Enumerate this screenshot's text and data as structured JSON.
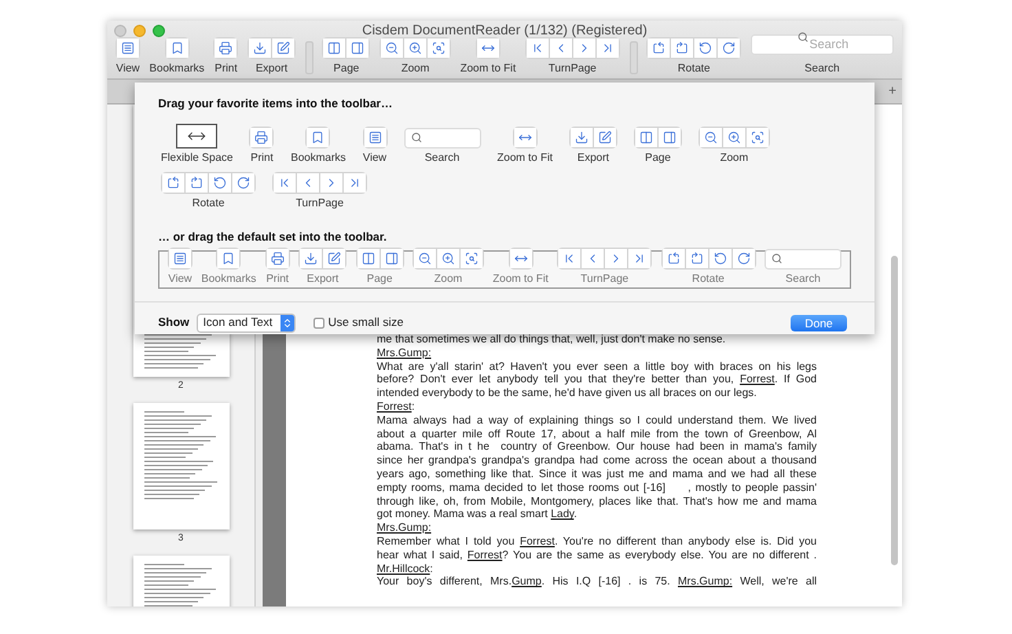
{
  "window": {
    "title": "Cisdem DocumentReader (1/132) (Registered)"
  },
  "toolbar": [
    {
      "kind": "buttons",
      "label": "View",
      "icons": [
        {
          "kind": "view"
        }
      ]
    },
    {
      "kind": "buttons",
      "label": "Bookmarks",
      "icons": [
        {
          "kind": "bookmark"
        }
      ]
    },
    {
      "kind": "buttons",
      "label": "Print",
      "icons": [
        {
          "kind": "print"
        }
      ]
    },
    {
      "kind": "buttons",
      "label": "Export",
      "icons": [
        {
          "kind": "export"
        },
        {
          "kind": "edit"
        }
      ]
    },
    {
      "kind": "spacer"
    },
    {
      "kind": "buttons",
      "label": "Page",
      "icons": [
        {
          "kind": "page-two"
        },
        {
          "kind": "page-side"
        }
      ]
    },
    {
      "kind": "buttons",
      "label": "Zoom",
      "icons": [
        {
          "kind": "zoom-out"
        },
        {
          "kind": "zoom-in"
        },
        {
          "kind": "zoom-actual"
        }
      ]
    },
    {
      "kind": "buttons",
      "label": "Zoom to Fit",
      "icons": [
        {
          "kind": "fit"
        }
      ]
    },
    {
      "kind": "buttons",
      "label": "TurnPage",
      "icons": [
        {
          "kind": "first"
        },
        {
          "kind": "prev"
        },
        {
          "kind": "next"
        },
        {
          "kind": "last"
        }
      ]
    },
    {
      "kind": "spacer"
    },
    {
      "kind": "buttons",
      "label": "Rotate",
      "icons": [
        {
          "kind": "rot-l"
        },
        {
          "kind": "rot-r"
        },
        {
          "kind": "rot-l2"
        },
        {
          "kind": "rot-r2"
        }
      ]
    },
    {
      "kind": "search",
      "label": "Search",
      "placeholder": "Search"
    }
  ],
  "tab_bar": {
    "add": "+"
  },
  "customize_sheet": {
    "heading": "Drag your favorite items into the toolbar…",
    "palette": [
      {
        "kind": "flex",
        "label": "Flexible Space"
      },
      {
        "kind": "buttons",
        "label": "Print",
        "icons": [
          {
            "kind": "print"
          }
        ]
      },
      {
        "kind": "buttons",
        "label": "Bookmarks",
        "icons": [
          {
            "kind": "bookmark"
          }
        ]
      },
      {
        "kind": "buttons",
        "label": "View",
        "icons": [
          {
            "kind": "view"
          }
        ]
      },
      {
        "kind": "search",
        "label": "Search"
      },
      {
        "kind": "buttons",
        "label": "Zoom to Fit",
        "icons": [
          {
            "kind": "fit"
          }
        ]
      },
      {
        "kind": "buttons",
        "label": "Export",
        "icons": [
          {
            "kind": "export"
          },
          {
            "kind": "edit"
          }
        ]
      },
      {
        "kind": "buttons",
        "label": "Page",
        "icons": [
          {
            "kind": "page-two"
          },
          {
            "kind": "page-side"
          }
        ]
      },
      {
        "kind": "buttons",
        "label": "Zoom",
        "icons": [
          {
            "kind": "zoom-out"
          },
          {
            "kind": "zoom-in"
          },
          {
            "kind": "zoom-actual"
          }
        ]
      },
      {
        "kind": "buttons",
        "label": "Rotate",
        "icons": [
          {
            "kind": "rot-l"
          },
          {
            "kind": "rot-r"
          },
          {
            "kind": "rot-l2"
          },
          {
            "kind": "rot-r2"
          }
        ]
      },
      {
        "kind": "buttons",
        "label": "TurnPage",
        "icons": [
          {
            "kind": "first"
          },
          {
            "kind": "prev"
          },
          {
            "kind": "next"
          },
          {
            "kind": "last"
          }
        ]
      }
    ],
    "default_heading": "… or drag the default set into the toolbar.",
    "default_set": [
      {
        "kind": "buttons",
        "label": "View",
        "icons": [
          {
            "kind": "view"
          }
        ]
      },
      {
        "kind": "buttons",
        "label": "Bookmarks",
        "icons": [
          {
            "kind": "bookmark"
          }
        ]
      },
      {
        "kind": "buttons",
        "label": "Print",
        "icons": [
          {
            "kind": "print"
          }
        ]
      },
      {
        "kind": "buttons",
        "label": "Export",
        "icons": [
          {
            "kind": "export"
          },
          {
            "kind": "edit"
          }
        ]
      },
      {
        "kind": "buttons",
        "label": "Page",
        "icons": [
          {
            "kind": "page-two"
          },
          {
            "kind": "page-side"
          }
        ]
      },
      {
        "kind": "buttons",
        "label": "Zoom",
        "icons": [
          {
            "kind": "zoom-out"
          },
          {
            "kind": "zoom-in"
          },
          {
            "kind": "zoom-actual"
          }
        ]
      },
      {
        "kind": "buttons",
        "label": "Zoom to Fit",
        "icons": [
          {
            "kind": "fit"
          }
        ]
      },
      {
        "kind": "buttons",
        "label": "TurnPage",
        "icons": [
          {
            "kind": "first"
          },
          {
            "kind": "prev"
          },
          {
            "kind": "next"
          },
          {
            "kind": "last"
          }
        ]
      },
      {
        "kind": "buttons",
        "label": "Rotate",
        "icons": [
          {
            "kind": "rot-l"
          },
          {
            "kind": "rot-r"
          },
          {
            "kind": "rot-l2"
          },
          {
            "kind": "rot-r2"
          }
        ]
      },
      {
        "kind": "search",
        "label": "Search"
      }
    ],
    "show_label": "Show",
    "show_value": "Icon and Text",
    "small_size": {
      "label": "Use small size",
      "checked": false
    },
    "done": "Done"
  },
  "thumbnails": [
    {
      "page": "2"
    },
    {
      "page": "3"
    }
  ],
  "document_lines": [
    {
      "justified": false,
      "segments": [
        {
          "text": "me that sometimes we all do things that, well, just don't make no sense.",
          "underline": false
        }
      ]
    },
    {
      "justified": false,
      "segments": [
        {
          "text": "Mrs.Gump:",
          "underline": true
        }
      ]
    },
    {
      "justified": true,
      "segments": [
        {
          "text": "What are y'all starin' at? Haven't you ever seen a little boy with braces on his legs",
          "underline": false
        }
      ]
    },
    {
      "justified": true,
      "segments": [
        {
          "text": "before? Don't ever let anybody tell you that they're better than you, ",
          "underline": false
        },
        {
          "text": "Forrest",
          "underline": true
        },
        {
          "text": ". If God",
          "underline": false
        }
      ]
    },
    {
      "justified": false,
      "segments": [
        {
          "text": "intended everybody to be the same, he'd have given us all braces on our legs.",
          "underline": false
        }
      ]
    },
    {
      "justified": false,
      "segments": [
        {
          "text": "Forrest",
          "underline": true
        },
        {
          "text": ":",
          "underline": false
        }
      ]
    },
    {
      "justified": true,
      "segments": [
        {
          "text": "Mama always had a way of explaining things so I could understand them. We lived",
          "underline": false
        }
      ]
    },
    {
      "justified": true,
      "segments": [
        {
          "text": "about a quarter mile off Route 17, about a half mile from the town of Greenbow, Al",
          "underline": false
        }
      ]
    },
    {
      "justified": true,
      "segments": [
        {
          "text": "abama. That's in t he  country of Greenbow. Our house had been in mama's family",
          "underline": false
        }
      ]
    },
    {
      "justified": true,
      "segments": [
        {
          "text": "since her grandpa's grandpa's grandpa had come across the ocean about a thousand",
          "underline": false
        }
      ]
    },
    {
      "justified": true,
      "segments": [
        {
          "text": "years ago, something like that. Since it was just me and mama and we had all these",
          "underline": false
        }
      ]
    },
    {
      "justified": true,
      "segments": [
        {
          "text": "empty rooms, mama decided to let those rooms out [-16]     , mostly to people passin'",
          "underline": false
        }
      ]
    },
    {
      "justified": true,
      "segments": [
        {
          "text": "through like, oh, from Mobile, Montgomery, places like that. That's how me and mama",
          "underline": false
        }
      ]
    },
    {
      "justified": false,
      "segments": [
        {
          "text": "got money. Mama was a real smart ",
          "underline": false
        },
        {
          "text": "Lady",
          "underline": true
        },
        {
          "text": ".",
          "underline": false
        }
      ]
    },
    {
      "justified": false,
      "segments": [
        {
          "text": "Mrs.Gump:",
          "underline": true
        }
      ]
    },
    {
      "justified": true,
      "segments": [
        {
          "text": "Remember what I told you ",
          "underline": false
        },
        {
          "text": "Forrest",
          "underline": true
        },
        {
          "text": ". You're no different than anybody else is. Did you",
          "underline": false
        }
      ]
    },
    {
      "justified": true,
      "segments": [
        {
          "text": "hear what I said, ",
          "underline": false
        },
        {
          "text": "Forrest",
          "underline": true
        },
        {
          "text": "? You are the same as everybody else. You are no different .",
          "underline": false
        }
      ]
    },
    {
      "justified": false,
      "segments": [
        {
          "text": "Mr.Hillcock",
          "underline": true
        },
        {
          "text": ":",
          "underline": false
        }
      ]
    },
    {
      "justified": true,
      "segments": [
        {
          "text": "Your boy's different, Mrs.",
          "underline": false
        },
        {
          "text": "Gump",
          "underline": true
        },
        {
          "text": ". His I.Q [-16] . is 75. ",
          "underline": false
        },
        {
          "text": "Mrs.Gump:",
          "underline": true
        },
        {
          "text": " Well, we're all",
          "underline": false
        }
      ]
    }
  ]
}
